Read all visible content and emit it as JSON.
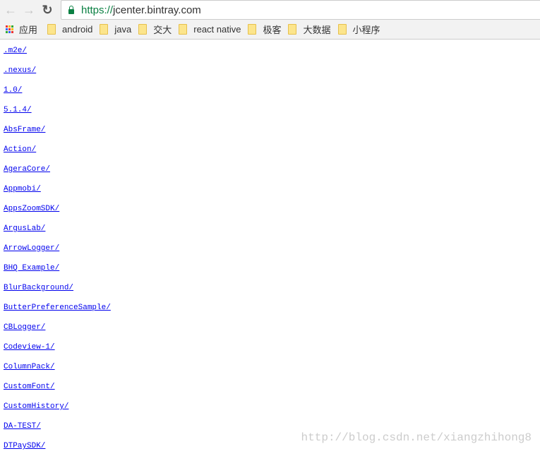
{
  "browser": {
    "url_scheme": "https://",
    "url_host": "jcenter.bintray.com"
  },
  "bookmarks": {
    "apps_label": "应用",
    "items": [
      "android",
      "java",
      "交大",
      "react native",
      "极客",
      "大数据",
      "小程序"
    ]
  },
  "listing": [
    ".",
    ".m2e/",
    ".nexus/",
    "1.0/",
    "5.1.4/",
    "AbsFrame/",
    "Action/",
    "AgeraCore/",
    "Appmobi/",
    "AppsZoomSDK/",
    "ArgusLab/",
    "ArrowLogger/",
    "BHQ Example/",
    "BlurBackground/",
    "ButterPreferenceSample/",
    "CBLogger/",
    "Codeview-1/",
    "ColumnPack/",
    "CustomFont/",
    "CustomHistory/",
    "DA-TEST/",
    "DTPaySDK/"
  ],
  "watermark": "http://blog.csdn.net/xiangzhihong8"
}
